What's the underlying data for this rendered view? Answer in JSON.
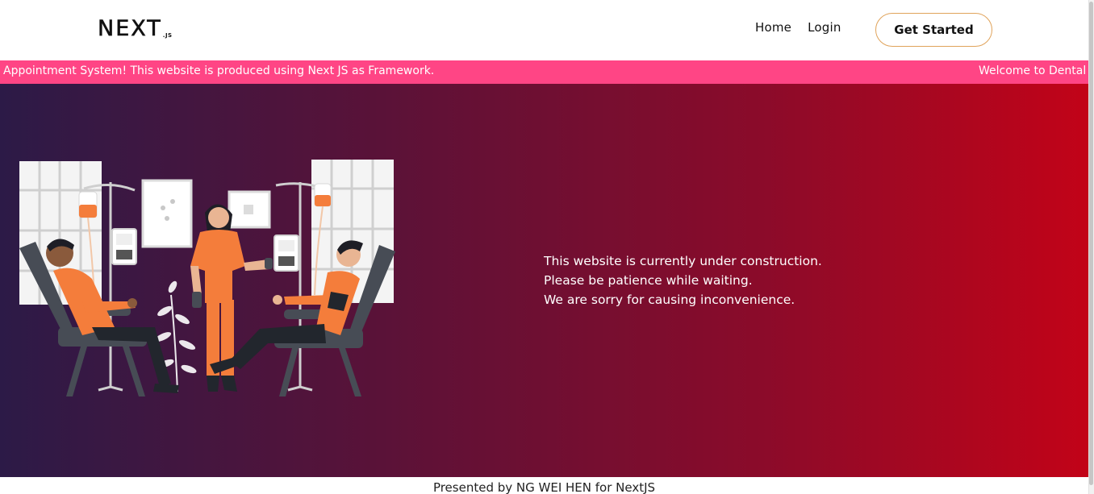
{
  "header": {
    "logo_main": "NEXT",
    "logo_sub": ".JS",
    "nav": [
      {
        "label": "Home"
      },
      {
        "label": "Login"
      }
    ],
    "cta_label": "Get Started"
  },
  "marquee": {
    "text_left": "Appointment System! This website is produced using Next JS as Framework.",
    "text_right": "Welcome to Dental"
  },
  "hero": {
    "message_lines": [
      "This website is currently under construction.",
      "Please be patience while waiting.",
      "We are sorry for causing inconvenience."
    ],
    "illustration_icon": "medical-clinic-illustration"
  },
  "footer": {
    "text": "Presented by NG WEI HEN for NextJS"
  },
  "colors": {
    "marquee_bg": "#ff4585",
    "hero_gradient_start": "#2c1a47",
    "hero_gradient_end": "#c20318",
    "cta_border": "#e0a35a",
    "accent_orange": "#f47d3b"
  }
}
